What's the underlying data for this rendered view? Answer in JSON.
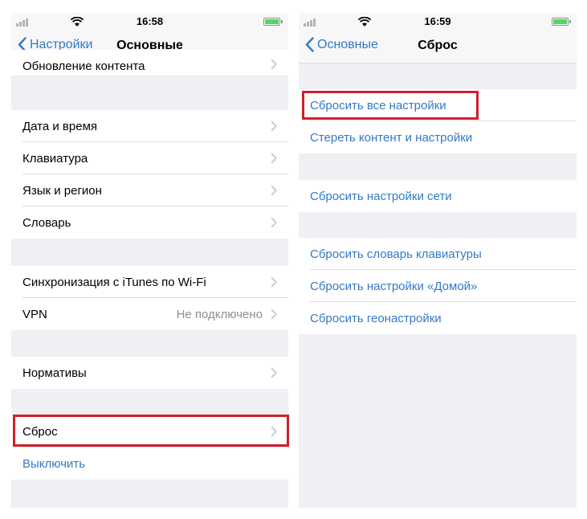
{
  "left": {
    "status": {
      "time": "16:58"
    },
    "nav": {
      "back_label": "Настройки",
      "title": "Основные"
    },
    "rows": {
      "content_update": "Обновление контента",
      "date_time": "Дата и время",
      "keyboard": "Клавиатура",
      "language_region": "Язык и регион",
      "dictionary": "Словарь",
      "itunes_wifi_sync": "Синхронизация с iTunes по Wi-Fi",
      "vpn": "VPN",
      "vpn_status": "Не подключено",
      "regulatory": "Нормативы",
      "reset": "Сброс",
      "shutdown": "Выключить"
    }
  },
  "right": {
    "status": {
      "time": "16:59"
    },
    "nav": {
      "back_label": "Основные",
      "title": "Сброс"
    },
    "rows": {
      "reset_all_settings": "Сбросить все настройки",
      "erase_content_settings": "Стереть контент и настройки",
      "reset_network": "Сбросить настройки сети",
      "reset_keyboard_dictionary": "Сбросить словарь клавиатуры",
      "reset_home_layout": "Сбросить настройки «Домой»",
      "reset_location_privacy": "Сбросить геонастройки"
    }
  },
  "colors": {
    "accent": "#3478c6",
    "highlight": "#d01f2a",
    "group_background": "#efeff4",
    "battery": "#4cd964"
  },
  "icons": [
    "signal-icon",
    "wifi-icon",
    "battery-icon",
    "back-chevron-icon",
    "chevron-right-icon"
  ]
}
